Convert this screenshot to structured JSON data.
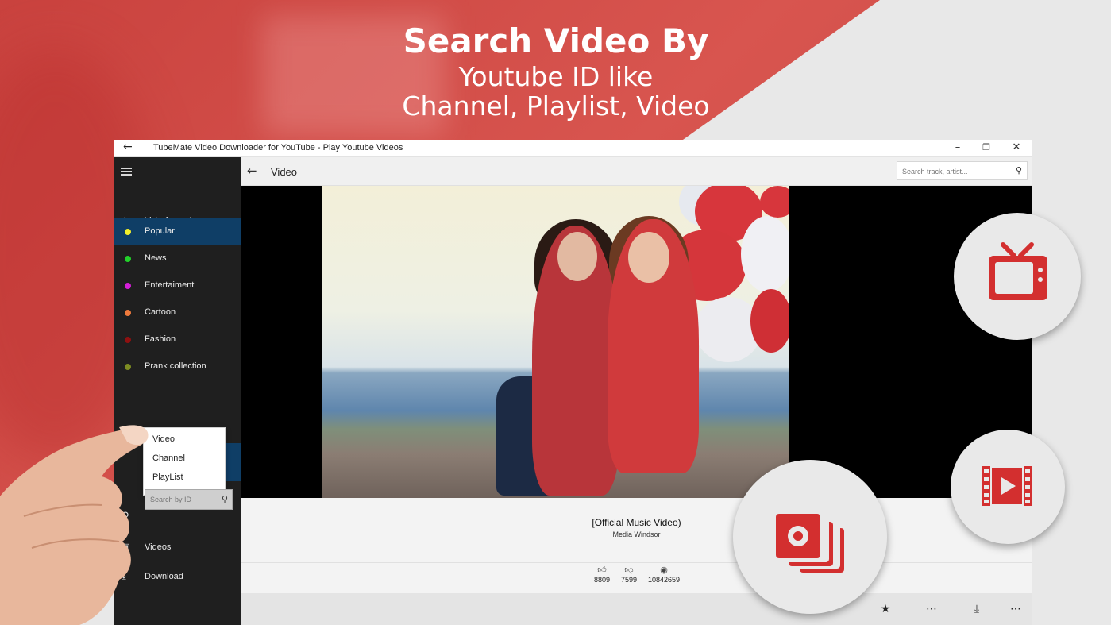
{
  "promo": {
    "line1": "Search Video By",
    "line2": "Youtube ID like",
    "line3": "Channel, Playlist, Video"
  },
  "window": {
    "title": "TubeMate Video Downloader for YouTube - Play Youtube Videos"
  },
  "sidebar": {
    "items": [
      {
        "label": "List of popular",
        "icon": "home-icon"
      },
      {
        "label": "Popular",
        "dot": "#f2ef2a"
      },
      {
        "label": "News",
        "dot": "#22d12a"
      },
      {
        "label": "Entertaiment",
        "dot": "#d51ed8"
      },
      {
        "label": "Cartoon",
        "dot": "#ef7a3c"
      },
      {
        "label": "Fashion",
        "dot": "#8e1010"
      },
      {
        "label": "Prank collection",
        "dot": "#7d8c22"
      }
    ],
    "search_type_options": [
      "Video",
      "Channel",
      "PlayList"
    ],
    "id_search_placeholder": "Search by ID",
    "videos_label": "Videos",
    "download_label": "Download"
  },
  "header": {
    "title": "Video",
    "search_placeholder": "Search track, artist..."
  },
  "video": {
    "title": "[Official Music Video)",
    "channel": "Media Windsor",
    "likes": "8809",
    "dislikes": "7599",
    "views": "10842659"
  },
  "colors": {
    "accent_red": "#d32f2f",
    "sidebar_active": "#0f3e66"
  }
}
